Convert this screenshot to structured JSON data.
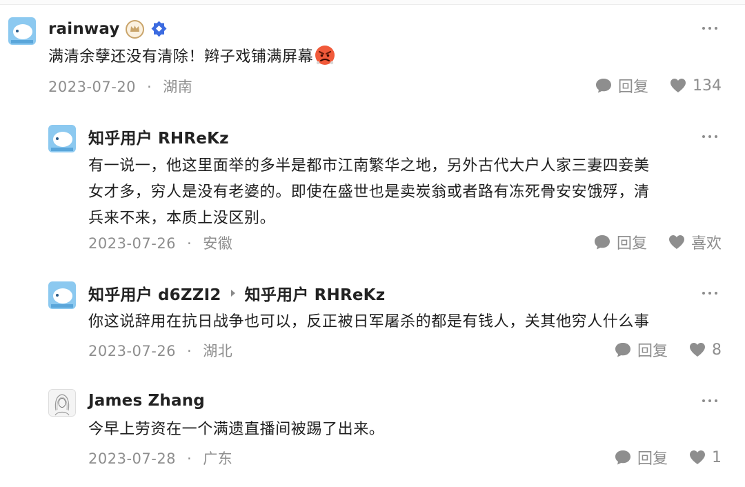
{
  "comments": [
    {
      "username": "rainway",
      "reply_to": "",
      "content": "满清余孽还没有清除！辫子戏铺满屏幕",
      "emoji": "angry-face",
      "date": "2023-07-20",
      "location": "湖南",
      "reply_label": "回复",
      "like_label": "134",
      "badges": [
        "crown-badge-icon",
        "verified-badge-icon"
      ]
    },
    {
      "username": "知乎用户 RHReKz",
      "reply_to": "",
      "content_lines": [
        "有一说一，他这里面举的多半是都市江南繁华之地，另外古代大户人家三妻四妾美",
        "女才多，穷人是没有老婆的。即使在盛世也是卖炭翁或者路有冻死骨安安饿殍，清",
        "兵来不来，本质上没区别。"
      ],
      "date": "2023-07-26",
      "location": "安徽",
      "reply_label": "回复",
      "like_label": "喜欢"
    },
    {
      "username": "知乎用户 d6ZZI2",
      "reply_to": "知乎用户 RHReKz",
      "content": "你这说辞用在抗日战争也可以，反正被日军屠杀的都是有钱人，关其他穷人什么事",
      "date": "2023-07-26",
      "location": "湖北",
      "reply_label": "回复",
      "like_label": "8"
    },
    {
      "username": "James Zhang",
      "reply_to": "",
      "content": "今早上劳资在一个满遗直播间被踢了出来。",
      "date": "2023-07-28",
      "location": "广东",
      "reply_label": "回复",
      "like_label": "1"
    }
  ],
  "colors": {
    "text_primary": "#1f1f1f",
    "text_secondary": "#8e8e8e",
    "avatar_blue": "#8cc9f0",
    "badge_gold": "#c9a46a",
    "badge_blue": "#3c6be0"
  },
  "icons": {
    "more": "more-dots-icon",
    "reply": "chat-bubble-icon",
    "like": "heart-icon"
  }
}
